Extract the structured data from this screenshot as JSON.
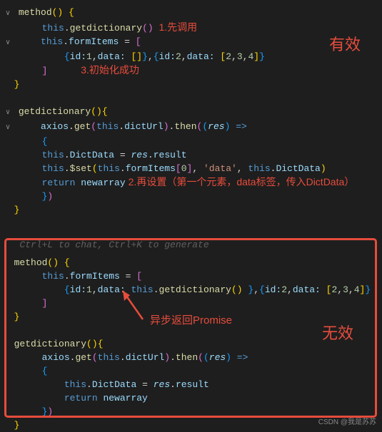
{
  "valid": {
    "title": "有效",
    "method_sig": "method",
    "call_dict": "getdictionary",
    "ann1": "1.先调用",
    "ann3": "3.初始化成功",
    "line_obj": "{id:1,data: []},{id:2,data: [2,3,4]}",
    "dict_sig": "getdictionary",
    "axios_text": "axios.get",
    "dictUrl": "dictUrl",
    "then": "then",
    "res": "res",
    "assign1": "this.DictData = res.result",
    "set_call": "$set",
    "set_args": "this.formItems[0], 'data', this.DictData",
    "ann2": "2.再设置（第一个元素，data标签，传入DictData）",
    "return": "return",
    "newarray": "newarray"
  },
  "invalid": {
    "title": "无效",
    "ghost": "Ctrl+L to chat, Ctrl+K to generate",
    "method_sig": "method",
    "line_obj1": "{id:1,data: this.getdictionary() },{id:2,data: [2,3,4]}",
    "ann_arrow": "异步返回Promise",
    "dict_sig": "getdictionary",
    "return": "return",
    "newarray": "newarray"
  },
  "watermark": "CSDN @我是苏苏",
  "colors": {
    "red": "#e74c3c"
  }
}
